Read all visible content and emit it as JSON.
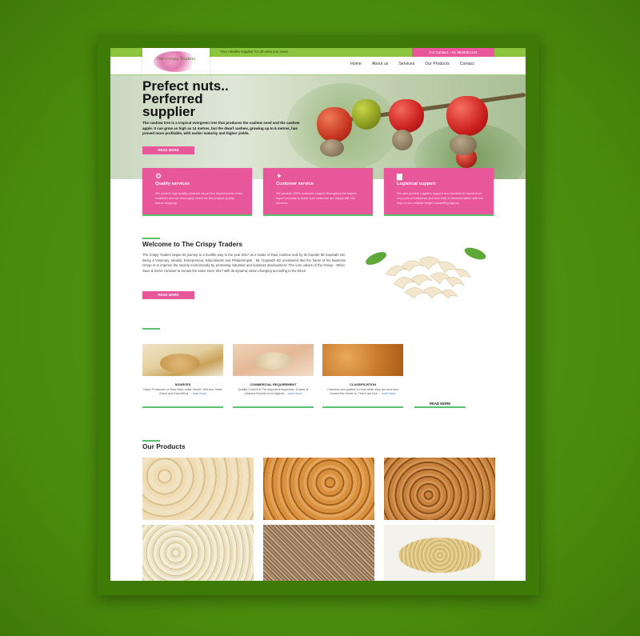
{
  "topbar": {
    "tagline": "Your reliable supplier for all what you need",
    "call": "For Contact: +91 9840051443"
  },
  "logo": {
    "text": "The Crispy Traders"
  },
  "nav": {
    "items": [
      "Home",
      "About us",
      "Services",
      "Our Products",
      "Contact"
    ]
  },
  "hero": {
    "title_line1": "Prefect nuts..",
    "title_line2": "Perferred",
    "title_line3": "supplier",
    "text": "The cashew tree is a tropical evergreen tree that produces the cashew seed and the cashew apple. It can grow as high as 14 metres, but the dwarf cashew, growing up to 6 metres, has proved more profitable, with earlier maturity and higher yields.",
    "button": "READ MORE"
  },
  "services": [
    {
      "icon": "gears-icon",
      "title": "Quality services",
      "text": "We provide high quality products as per the requirements of the customer and we thoroughly check for the product quality before shipping."
    },
    {
      "icon": "handshake-icon",
      "title": "Customer service",
      "text": "We provide 100% customer support throughout the import-export process to make sure customer are happy with the services."
    },
    {
      "icon": "truck-icon",
      "title": "Logistical support",
      "text": "We also provide Logistics support and services to export from any ports of Indonesia and also help in documentation with the help of own reliable freight forwarding Agents."
    }
  ],
  "welcome": {
    "title": "Welcome to The Crispy Traders",
    "text": "The Crispy Traders began its journey in a humble way in the year 2017 as a trader of Raw Cashew nuts by its founder Mr.Gopinath KD. Being a Visionary, Idealist, Entrepreneur, Educationist and Philanthropist , Mr. Gopinath KD envisioned that the future of his Business Group is to improve the society economically by promoting industrial and business development. The core values of the Group - Strive, Save & Serve continue to remain the same since 2017 with its dynamic vision changing according to the times.",
    "button": "READ MORE"
  },
  "features": [
    {
      "title": "SOURCES",
      "text": "Major Producers of Raw Nuts: India, Brazil, Vietnam, West Africa and East Africa ...",
      "more": "read more"
    },
    {
      "title": "COMMERCIAL REQUIREMENT",
      "text": "Quality Control & Pre-shipment Inspection. Export of Cashew Kernels from Nigeria ...",
      "more": "read more"
    },
    {
      "title": "CLASSIFICATION",
      "text": "Cashews are graded on how white they are and how broken the kernel is. There are four ...",
      "more": "read more"
    }
  ],
  "feature_button": "READ MORE",
  "products": {
    "title": "Our Products"
  },
  "colors": {
    "pink": "#e8579a",
    "green": "#5ac26b",
    "lime": "#8cc63f",
    "frame": "#4e8a10"
  }
}
